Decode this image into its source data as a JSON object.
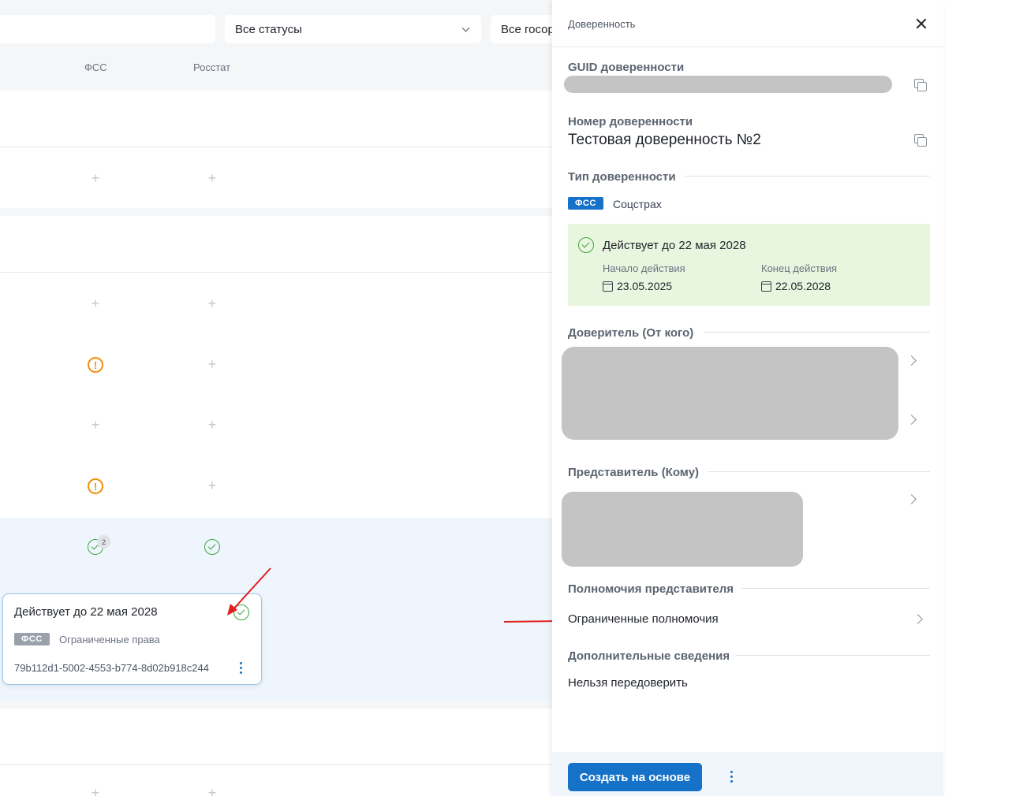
{
  "filters": {
    "search_value": "",
    "status_value": "Все статусы",
    "gos_value": "Все госорганы"
  },
  "table": {
    "columns": [
      "ФСС",
      "Росстат"
    ]
  },
  "hover_card": {
    "title": "Действует до 22 мая 2028",
    "tag": "ФСС",
    "tag_label": "Ограниченные права",
    "guid": "79b112d1-5002-4553-b774-8d02b918c244"
  },
  "badge_count": "2",
  "panel": {
    "title": "Доверенность",
    "guid_label": "GUID доверенности",
    "number_label": "Номер доверенности",
    "number_value": "Тестовая доверенность №2",
    "type_label": "Тип доверенности",
    "type_tag": "ФСС",
    "type_name": "Соцстрах",
    "validity": {
      "title": "Действует до 22 мая 2028",
      "start_label": "Начало действия",
      "start_date": "23.05.2025",
      "end_label": "Конец действия",
      "end_date": "22.05.2028"
    },
    "principal_label": "Доверитель (От кого)",
    "representative_label": "Представитель (Кому)",
    "powers_label": "Полномочия представителя",
    "powers_value": "Ограниченные полномочия",
    "extra_label": "Дополнительные сведения",
    "extra_value": "Нельзя передоверить",
    "create_button": "Создать на основе"
  },
  "colors": {
    "accent": "#1672c9",
    "success": "#3fa63f",
    "warning": "#f0900c",
    "validity_bg": "#e9f6df"
  }
}
